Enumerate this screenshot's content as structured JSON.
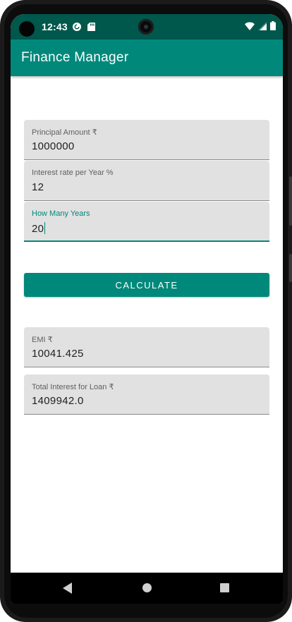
{
  "status_bar": {
    "time": "12:43",
    "notification_icons": [
      "pocket-casts-icon",
      "sd-card-icon"
    ],
    "system_icons": [
      "wifi-icon",
      "cellular-signal-icon",
      "battery-icon"
    ]
  },
  "app_bar": {
    "title": "Finance Manager"
  },
  "form": {
    "principal": {
      "label": "Principal Amount ₹",
      "value": "1000000"
    },
    "interest": {
      "label": "Interest rate per Year %",
      "value": "12"
    },
    "years": {
      "label": "How Many Years",
      "value": "20"
    },
    "calculate_label": "CALCULATE"
  },
  "results": {
    "emi": {
      "label": "EMI ₹",
      "value": "10041.425"
    },
    "total_interest": {
      "label": "Total Interest for Loan ₹",
      "value": "1409942.0"
    }
  },
  "colors": {
    "primary": "#00897b",
    "primary_dark": "#00574b",
    "field_background": "#e1e1e1"
  },
  "nav_bar": {
    "buttons": [
      "back-icon",
      "home-icon",
      "recents-icon"
    ]
  }
}
